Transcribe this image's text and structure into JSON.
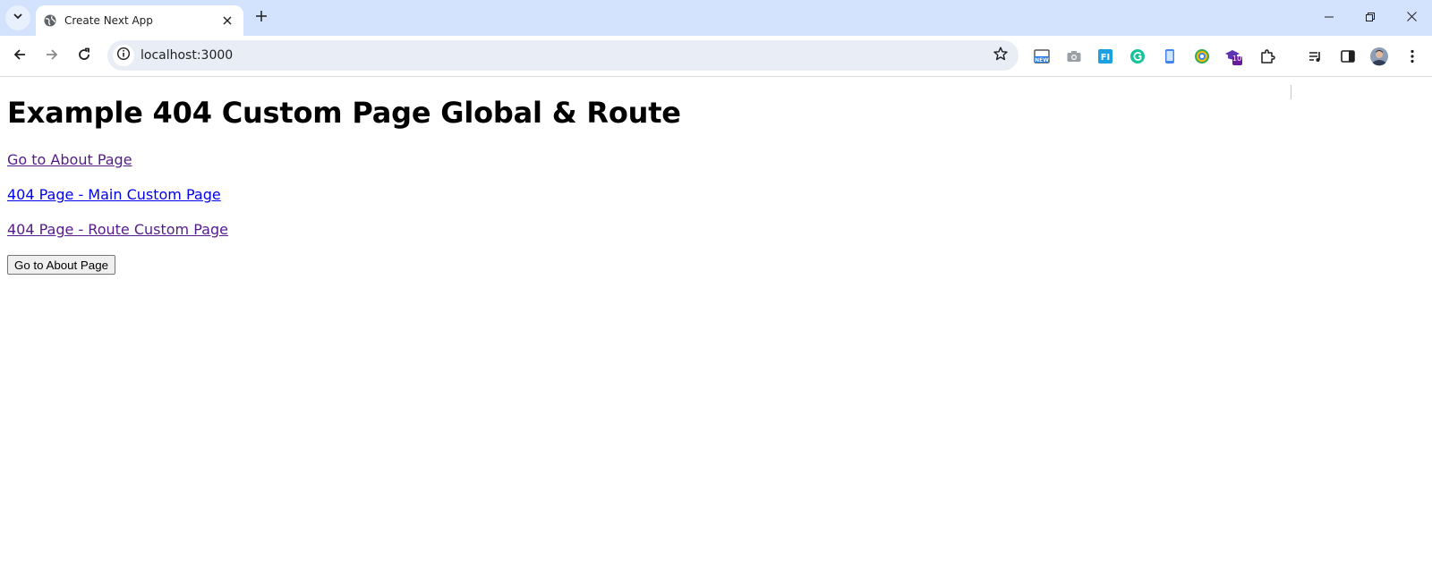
{
  "browser": {
    "tab_title": "Create Next App",
    "url": "localhost:3000",
    "extension_badge": "10"
  },
  "icons": {
    "tab_search": "chevron-down-icon",
    "tab_favicon": "globe-icon",
    "tab_close": "close-icon",
    "new_tab": "plus-icon",
    "back": "back-arrow-icon",
    "forward": "forward-arrow-icon",
    "reload": "reload-icon",
    "site_info": "info-icon",
    "bookmark": "star-icon",
    "extensions_menu": "puzzle-icon",
    "media": "media-queue-icon",
    "side_panel": "side-panel-icon",
    "profile": "avatar-icon",
    "menu": "kebab-menu-icon"
  },
  "colors": {
    "tabstrip_bg": "#d3e3fd",
    "omnibox_bg": "#e9eef6",
    "link_visited": "#551a8b",
    "link_unvisited": "#0000ee"
  },
  "page": {
    "heading": "Example 404 Custom Page Global & Route",
    "links": [
      {
        "label": "Go to About Page",
        "state": "visited"
      },
      {
        "label": "404 Page - Main Custom Page",
        "state": "unvisited"
      },
      {
        "label": "404 Page - Route Custom Page",
        "state": "visited"
      }
    ],
    "button_label": "Go to About Page"
  }
}
